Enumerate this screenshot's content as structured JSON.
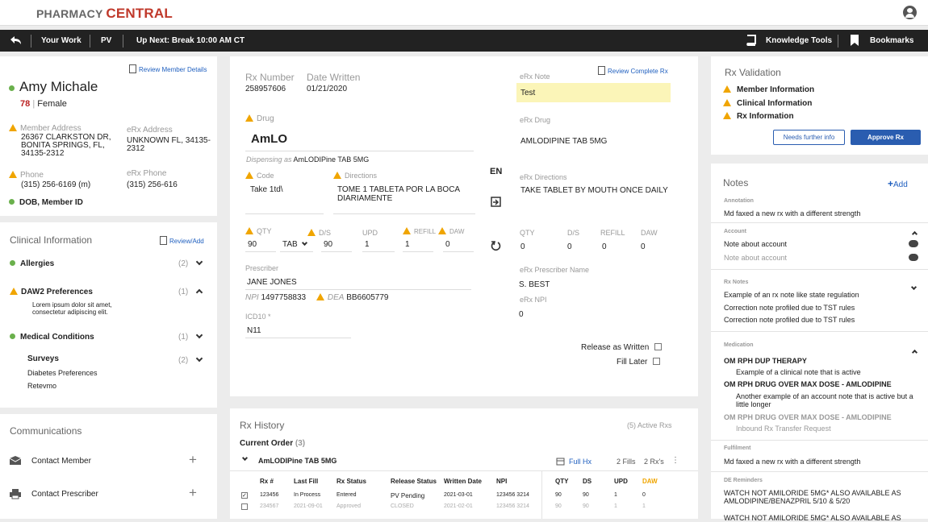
{
  "app": {
    "brand_a": "PHARMACY",
    "brand_b": "CENTRAL"
  },
  "nav": {
    "your_work": "Your Work",
    "pv": "PV",
    "up_next": "Up Next: Break 10:00 AM CT",
    "knowledge": "Knowledge Tools",
    "bookmarks": "Bookmarks"
  },
  "member": {
    "review_link": "Review Member Details",
    "name": "Amy Michale",
    "age": "78",
    "sep": "|",
    "gender": "Female",
    "addr_label": "Member Address",
    "addr": "26367 CLARKSTON DR, BONITA SPRINGS, FL, 34135-2312",
    "erx_addr_label": "eRx Address",
    "erx_addr": "UNKNOWN FL, 34135-2312",
    "phone_label": "Phone",
    "phone": "(315) 256-6169 (m)",
    "erx_phone_label": "eRx Phone",
    "erx_phone": "(315) 256-616",
    "dob": "DOB, Member ID"
  },
  "clinical": {
    "title": "Clinical Information",
    "review": "Review/Add",
    "allergies": "Allergies",
    "allergies_count": "(2)",
    "daw2": "DAW2 Preferences",
    "daw2_count": "(1)",
    "daw2_text": "Lorem ipsum dolor sit amet, consectetur adipiscing elit.",
    "medical": "Medical Conditions",
    "medical_count": "(1)",
    "surveys": "Surveys",
    "surveys_count": "(2)",
    "survey1": "Diabetes Preferences",
    "survey2": "Retevmo"
  },
  "comms": {
    "title": "Communications",
    "contact_member": "Contact Member",
    "contact_prescriber": "Contact Prescriber"
  },
  "rx": {
    "rx_number_label": "Rx Number",
    "rx_number": "258957606",
    "date_label": "Date Written",
    "date": "01/21/2020",
    "review_complete": "Review Complete Rx",
    "erx_note_label": "eRx Note",
    "erx_note": "Test",
    "drug_label": "Drug",
    "drug": "AmLO",
    "dispensing_prefix": "Dispensing as",
    "dispensing_drug": "AmLODIPine TAB 5MG",
    "erx_drug_label": "eRx Drug",
    "erx_drug": "AMLODIPINE TAB 5MG",
    "code_label": "Code",
    "code": "Take 1td\\",
    "directions_label": "Directions",
    "directions": "TOME 1 TABLETA POR LA BOCA DIARIAMENTE",
    "lang": "EN",
    "erx_dir_label": "eRx Directions",
    "erx_dir": "TAKE TABLET BY MOUTH ONCE DAILY",
    "qty_label": "QTY",
    "ds_label": "D/S",
    "upd_label": "UPD",
    "refill_label": "REFILL",
    "daw_label": "DAW",
    "qty": "90",
    "unit": "TAB",
    "ds": "90",
    "upd": "1",
    "refill": "1",
    "daw": "0",
    "eqty": "0",
    "eds": "0",
    "eupd": "0",
    "erefill": "0",
    "edaw": "0",
    "prescriber_label": "Prescriber",
    "prescriber": "JANE JONES",
    "npi_label": "NPI",
    "npi": "1497758833",
    "dea_label": "DEA",
    "dea": "BB6605779",
    "erx_pres_label": "eRx Prescriber Name",
    "erx_pres": "S. BEST",
    "erx_npi_label": "eRx NPI",
    "erx_npi": "0",
    "icd_label": "ICD10 *",
    "icd": "N11",
    "release": "Release as Written",
    "fill_later": "Fill Later"
  },
  "history": {
    "title": "Rx History",
    "active": "(5) Active Rxs",
    "current": "Current Order",
    "current_count": "(3)",
    "drug": "AmLODIPine TAB 5MG",
    "full_hx": "Full Hx",
    "fills": "2 Fills",
    "rxs": "2 Rx's",
    "headers": [
      "Rx #",
      "Last Fill",
      "Rx Status",
      "Release Status",
      "Written Date",
      "NPI",
      "QTY",
      "DS",
      "UPD",
      "DAW"
    ],
    "rows": [
      [
        "123456",
        "In Process",
        "Entered",
        "PV Pending",
        "2021-03-01",
        "123456 3214",
        "90",
        "90",
        "1",
        "0"
      ],
      [
        "234567",
        "2021-09-01",
        "Approved",
        "CLOSED",
        "2021-02-01",
        "123456 3214",
        "90",
        "90",
        "1",
        "1"
      ]
    ]
  },
  "validation": {
    "title": "Rx Validation",
    "items": [
      "Member Information",
      "Clinical Information",
      "Rx Information"
    ],
    "needs": "Needs further info",
    "approve": "Approve Rx"
  },
  "notes": {
    "title": "Notes",
    "add": "Add",
    "annotation_h": "Annotation",
    "annotation": "Md faxed a new rx with a different strength",
    "account_h": "Account",
    "account1": "Note about account",
    "account2": "Note about account",
    "rxnotes_h": "Rx Notes",
    "rxnote1": "Example of an rx note like state regulation",
    "rxnote2": "Correction note profiled due to TST rules",
    "rxnote3": "Correction note profiled due to TST rules",
    "med_h": "Medication",
    "med1": "OM RPH DUP THERAPY",
    "med1_sub": "Example of a clinical note that is active",
    "med2": "OM RPH DRUG OVER MAX DOSE - AMLODIPINE",
    "med2_sub": "Another example of an account note that is active but a little longer",
    "med3": "OM RPH DRUG OVER MAX DOSE - AMLODIPINE",
    "med3_sub": "Inbound Rx Transfer Request",
    "fulfil_h": "Fulfilment",
    "fulfil": "Md faxed a new rx with a different strength",
    "de_h": "DE Reminders",
    "de1": "WATCH NOT AMILORIDE 5MG* ALSO AVAILABLE AS AMLODIPINE/BENAZPRIL 5/10 & 5/20",
    "de2": "WATCH NOT AMILORIDE 5MG* ALSO AVAILABLE AS"
  }
}
